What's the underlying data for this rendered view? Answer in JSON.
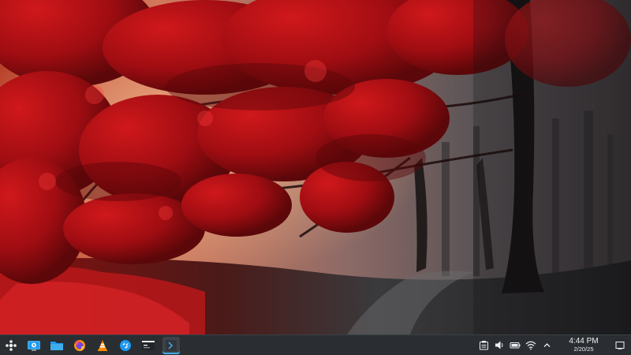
{
  "desktop": {
    "wallpaper": "red-autumn-forest-fog",
    "accent_color": "#c8141a"
  },
  "panel": {
    "background_color": "#2a2e32",
    "launchers": [
      {
        "name": "application-launcher",
        "icon": "kde-launcher-icon"
      },
      {
        "name": "system-settings",
        "icon": "system-settings-icon"
      },
      {
        "name": "file-manager",
        "icon": "folder-icon"
      },
      {
        "name": "firefox",
        "icon": "firefox-icon"
      },
      {
        "name": "vlc",
        "icon": "vlc-cone-icon"
      },
      {
        "name": "discover",
        "icon": "discover-icon"
      },
      {
        "name": "terminal",
        "icon": "terminal-icon"
      },
      {
        "name": "active-window",
        "icon": "terminal-window-icon"
      }
    ],
    "tray": {
      "icons": [
        "clipboard-icon",
        "volume-icon",
        "battery-icon",
        "wifi-icon",
        "expand-arrow-icon"
      ],
      "clock": {
        "time": "4:44 PM",
        "date": "2/20/25"
      }
    }
  }
}
